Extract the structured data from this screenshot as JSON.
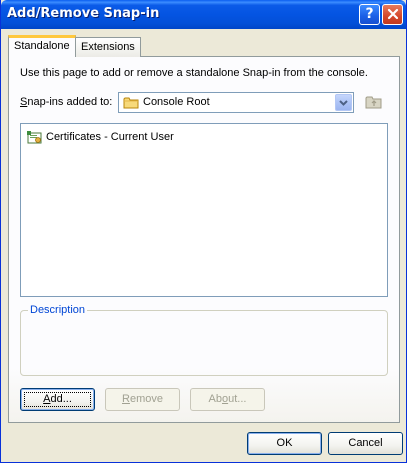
{
  "window": {
    "title": "Add/Remove Snap-in"
  },
  "tabs": [
    {
      "label": "Standalone",
      "active": true
    },
    {
      "label": "Extensions",
      "active": false
    }
  ],
  "panel": {
    "intro_text": "Use this page to add or remove a standalone Snap-in from the console.",
    "snapins_label_pre": "",
    "snapins_label_accel": "S",
    "snapins_label_post": "nap-ins added to:",
    "snapins_select_value": "Console Root",
    "snapins_list": [
      {
        "label": "Certificates - Current User",
        "icon": "certificates-icon"
      }
    ],
    "description_legend": "Description",
    "description_text": ""
  },
  "buttons": {
    "add": {
      "accel": "A",
      "rest": "dd...",
      "enabled": true
    },
    "remove": {
      "accel": "R",
      "rest": "emove",
      "enabled": false
    },
    "about": {
      "pre": "Ab",
      "accel": "o",
      "rest": "ut...",
      "enabled": false
    },
    "ok": {
      "label": "OK"
    },
    "cancel": {
      "label": "Cancel"
    }
  },
  "colors": {
    "titlebar": "#0454e2",
    "dialog_bg": "#ece9d8",
    "group_legend": "#0046d5",
    "active_tab_accent": "#ffc83c"
  }
}
